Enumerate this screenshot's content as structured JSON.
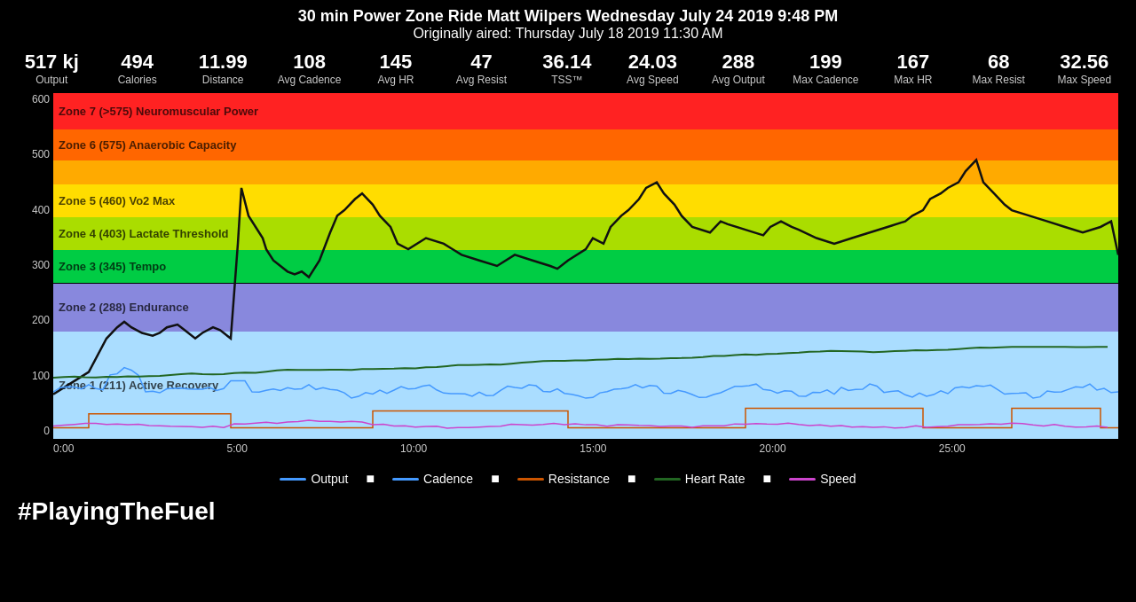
{
  "header": {
    "title": "30 min Power Zone Ride Matt Wilpers Wednesday July 24 2019 9:48 PM",
    "subtitle": "Originally aired: Thursday July 18 2019 11:30 AM"
  },
  "stats": [
    {
      "value": "517 kj",
      "label": "Output"
    },
    {
      "value": "494",
      "label": "Calories"
    },
    {
      "value": "11.99",
      "label": "Distance"
    },
    {
      "value": "108",
      "label": "Avg Cadence"
    },
    {
      "value": "145",
      "label": "Avg HR"
    },
    {
      "value": "47",
      "label": "Avg Resist"
    },
    {
      "value": "36.14",
      "label": "TSS™"
    },
    {
      "value": "24.03",
      "label": "Avg Speed"
    },
    {
      "value": "288",
      "label": "Avg Output"
    },
    {
      "value": "199",
      "label": "Max Cadence"
    },
    {
      "value": "167",
      "label": "Max HR"
    },
    {
      "value": "68",
      "label": "Max Resist"
    },
    {
      "value": "32.56",
      "label": "Max Speed"
    }
  ],
  "zones": [
    {
      "label": "Zone 7 (>575) Neuromuscular Power",
      "color": "#ff2222",
      "topPct": 0,
      "heightPct": 10.5
    },
    {
      "label": "Zone 6 (575) Anaerobic Capacity",
      "color": "#ff6600",
      "topPct": 10.5,
      "heightPct": 9
    },
    {
      "label": "",
      "color": "#ffaa00",
      "topPct": 19.5,
      "heightPct": 7
    },
    {
      "label": "Zone 5 (460) Vo2 Max",
      "color": "#ffdd00",
      "topPct": 26.5,
      "heightPct": 9.5
    },
    {
      "label": "Zone 4 (403) Lactate Threshold",
      "color": "#aadd00",
      "topPct": 36,
      "heightPct": 9.5
    },
    {
      "label": "Zone 3 (345) Tempo",
      "color": "#00cc44",
      "topPct": 45.5,
      "heightPct": 9.5
    },
    {
      "label": "Zone 2 (288) Endurance",
      "color": "#8888dd",
      "topPct": 55,
      "heightPct": 14
    },
    {
      "label": "Zone 1 (211) Active Recovery",
      "color": "#aaddff",
      "topPct": 69,
      "heightPct": 31
    }
  ],
  "yLabels": [
    "0",
    "100",
    "200",
    "300",
    "400",
    "500",
    "600"
  ],
  "xLabels": [
    "0:00",
    "5:00",
    "10:00",
    "15:00",
    "20:00",
    "25:00"
  ],
  "legend": [
    {
      "label": "Output",
      "color": "#4488ff"
    },
    {
      "label": "Cadence",
      "color": "#4488ff"
    },
    {
      "label": "Resistance",
      "color": "#bb4400"
    },
    {
      "label": "Heart Rate",
      "color": "#226622"
    },
    {
      "label": "Speed",
      "color": "#cc44cc"
    }
  ],
  "hashtag": "#PlayingTheFuel"
}
